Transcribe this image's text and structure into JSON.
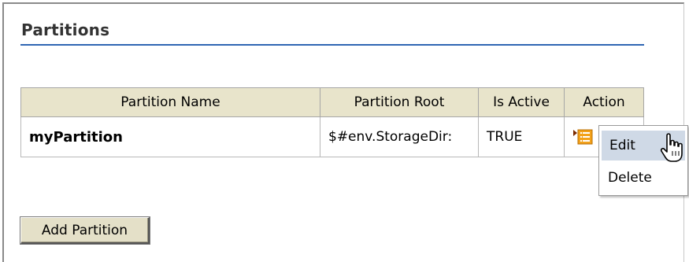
{
  "section": {
    "title": "Partitions"
  },
  "table": {
    "headers": [
      "Partition Name",
      "Partition Root",
      "Is Active",
      "Action"
    ],
    "rows": [
      {
        "name": "myPartition",
        "root": "$#env.StorageDir:",
        "active": "TRUE",
        "action_icon": "action-menu-icon"
      }
    ]
  },
  "context_menu": {
    "items": [
      "Edit",
      "Delete"
    ],
    "highlighted": "Edit"
  },
  "buttons": {
    "add_partition": "Add Partition"
  },
  "colors": {
    "accent_rule": "#2f66b3",
    "header_bg": "#e8e4cb",
    "menu_highlight": "#cfd9e6",
    "icon_orange": "#f3a21b"
  }
}
